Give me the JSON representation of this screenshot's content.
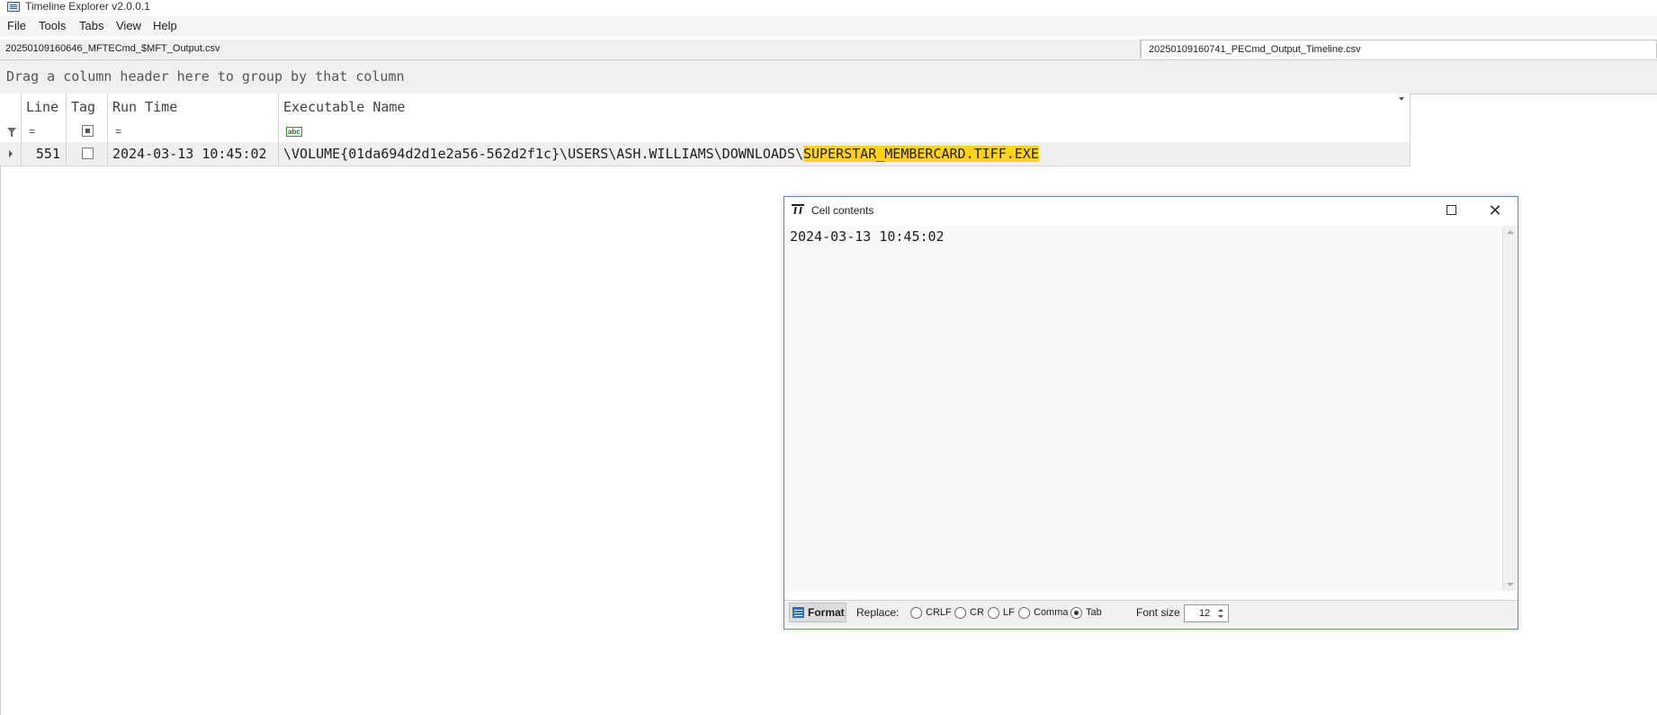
{
  "app": {
    "title": "Timeline Explorer v2.0.0.1"
  },
  "menu": [
    "File",
    "Tools",
    "Tabs",
    "View",
    "Help"
  ],
  "tabs": [
    "20250109160646_MFTECmd_$MFT_Output.csv",
    "20250109160741_PECmd_Output_Timeline.csv"
  ],
  "group_panel": {
    "text": "Drag a column header here to group by that column"
  },
  "grid": {
    "columns": [
      "Line",
      "Tag",
      "Run Time",
      "Executable Name"
    ],
    "filters": {
      "line": "=",
      "run_time": "="
    },
    "rows": [
      {
        "line": "551",
        "tag": false,
        "run_time": "2024-03-13 10:45:02",
        "exe_prefix": "\\VOLUME{01da694d2d1e2a56-562d2f1c}\\USERS\\ASH.WILLIAMS\\DOWNLOADS\\",
        "exe_highlight": "SUPERSTAR_MEMBERCARD.TIFF.EXE"
      }
    ]
  },
  "dialog": {
    "title": "Cell contents",
    "content": "2024-03-13 10:45:02",
    "footer": {
      "format_label": "Format",
      "replace_label": "Replace:",
      "options": [
        "CRLF",
        "CR",
        "LF",
        "Comma",
        "Tab"
      ],
      "selected": "Tab",
      "font_size_label": "Font size",
      "font_size": "12"
    }
  },
  "colors": {
    "highlight": "#ffd21f",
    "dialog_border": "#5a8ccc"
  }
}
